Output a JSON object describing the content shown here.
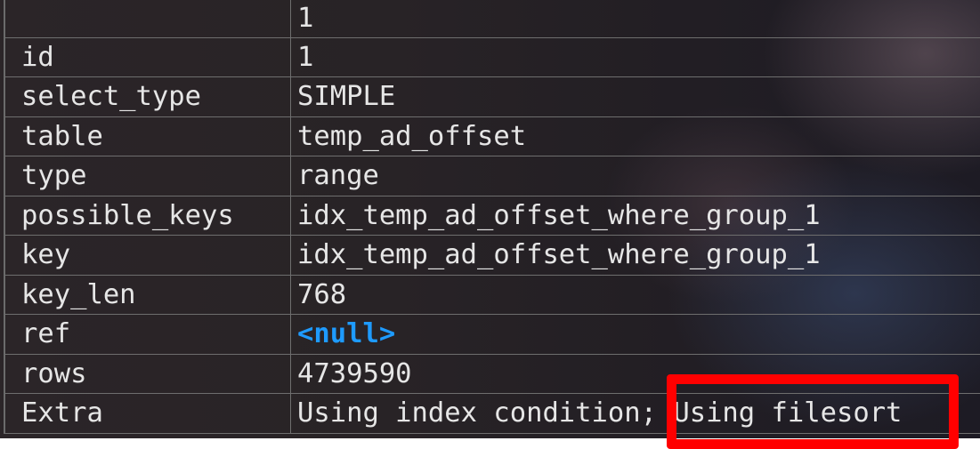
{
  "header": {
    "label": "",
    "value": "1"
  },
  "rows": [
    {
      "label": "id",
      "value": "1"
    },
    {
      "label": "select_type",
      "value": "SIMPLE"
    },
    {
      "label": "table",
      "value": "temp_ad_offset"
    },
    {
      "label": "type",
      "value": "range"
    },
    {
      "label": "possible_keys",
      "value": "idx_temp_ad_offset_where_group_1"
    },
    {
      "label": "key",
      "value": "idx_temp_ad_offset_where_group_1"
    },
    {
      "label": "key_len",
      "value": "768"
    },
    {
      "label": "ref",
      "value": "<null>",
      "is_null": true
    },
    {
      "label": "rows",
      "value": "4739590"
    },
    {
      "label": "Extra",
      "value": "Using index condition; Using filesort"
    }
  ],
  "colors": {
    "null": "#1e9bff",
    "highlight": "#ff0000"
  }
}
